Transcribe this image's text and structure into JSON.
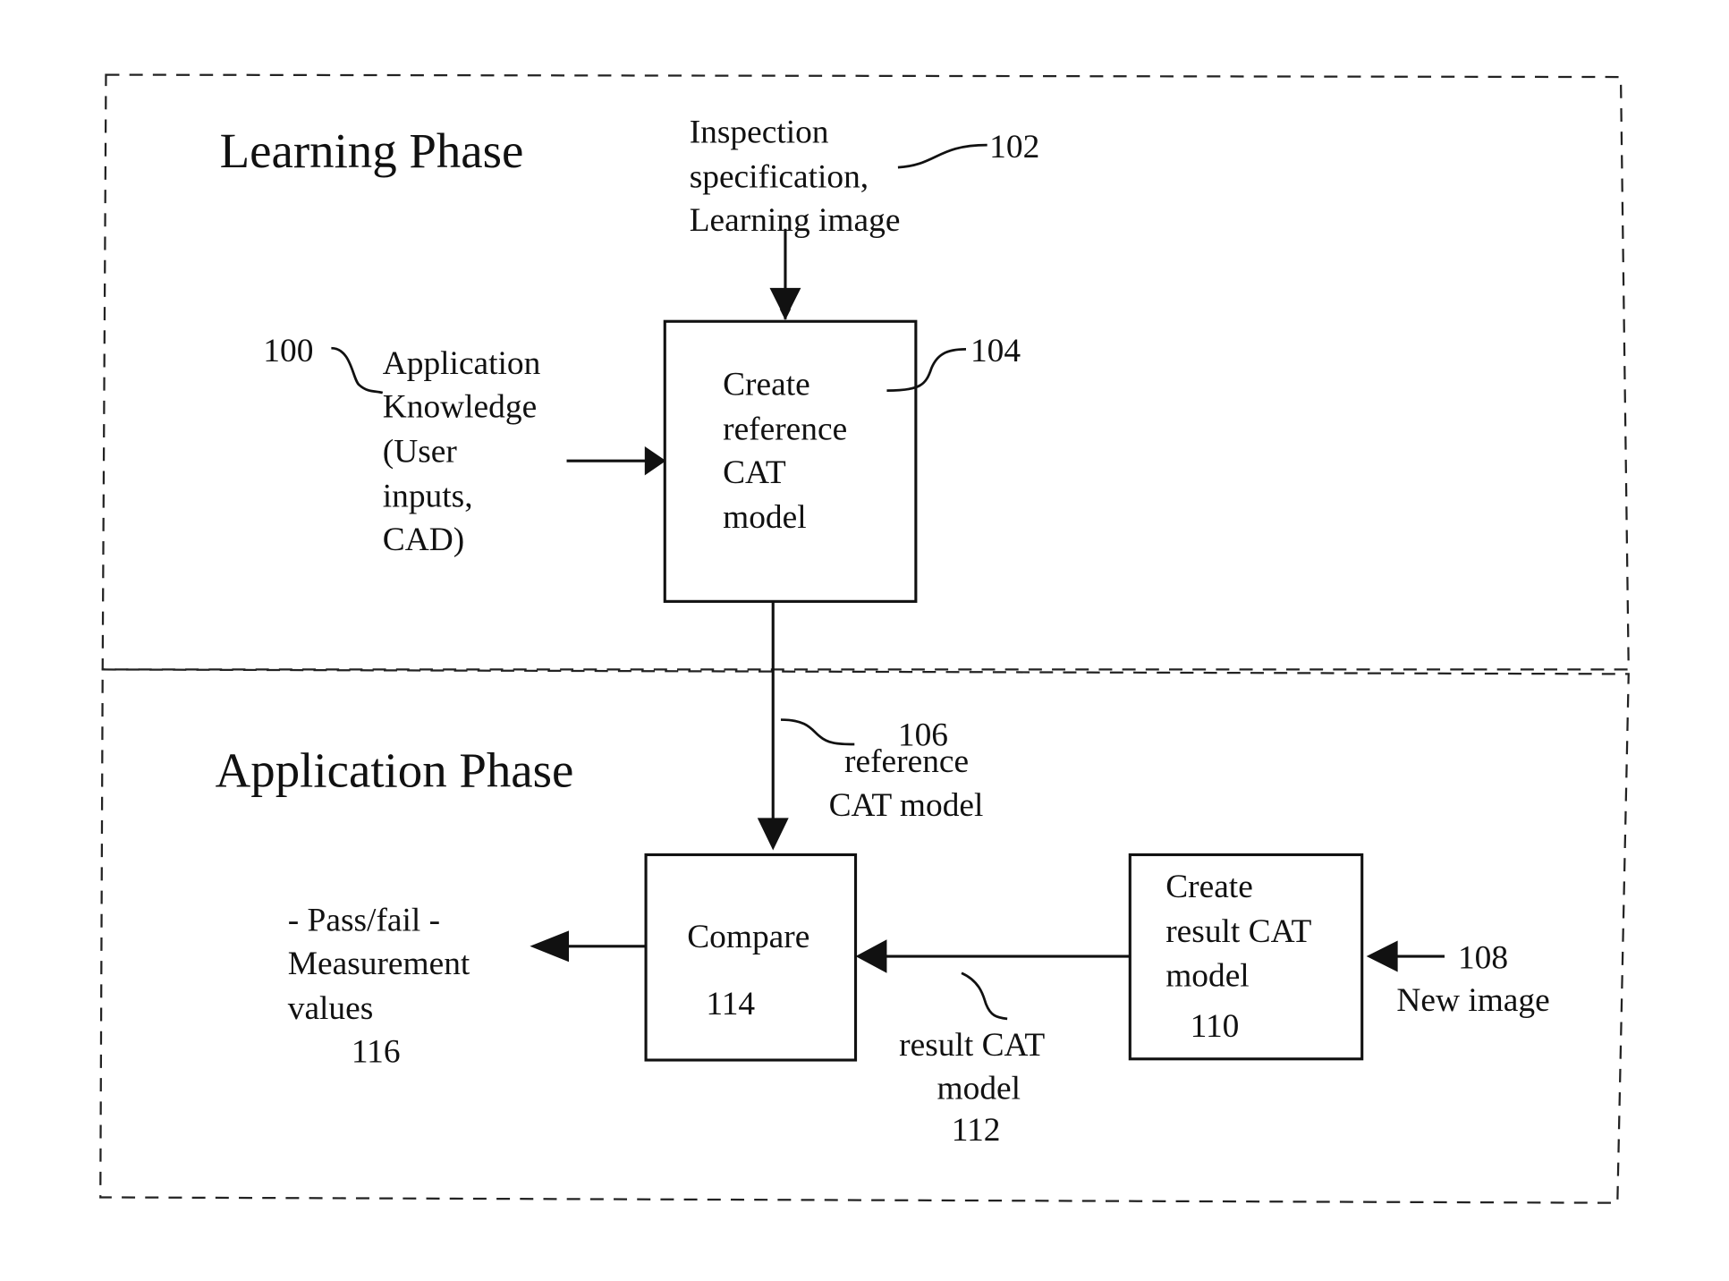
{
  "phases": {
    "learning": "Learning Phase",
    "application": "Application Phase"
  },
  "nodes": {
    "input_102": {
      "lines": [
        "Inspection",
        "specification,",
        "Learning image"
      ],
      "ref": "102"
    },
    "knowledge_100": {
      "lines": [
        "Application",
        "Knowledge",
        "(User",
        "inputs,",
        "CAD)"
      ],
      "ref": "100"
    },
    "create_reference_104": {
      "lines": [
        "Create",
        "reference",
        "CAT",
        "model"
      ],
      "ref": "104"
    },
    "reference_model_106": {
      "lines": [
        "reference",
        "CAT model"
      ],
      "ref": "106"
    },
    "compare_114": {
      "lines": [
        "Compare"
      ],
      "ref": "114"
    },
    "create_result_110": {
      "lines": [
        "Create",
        "result CAT",
        "model"
      ],
      "ref": "110"
    },
    "new_image_108": {
      "lines": [
        "New image"
      ],
      "ref": "108"
    },
    "result_model_112": {
      "lines": [
        "result CAT",
        "model"
      ],
      "ref": "112"
    },
    "output_116": {
      "lines": [
        "- Pass/fail -",
        "Measurement",
        "values"
      ],
      "ref": "116"
    }
  }
}
